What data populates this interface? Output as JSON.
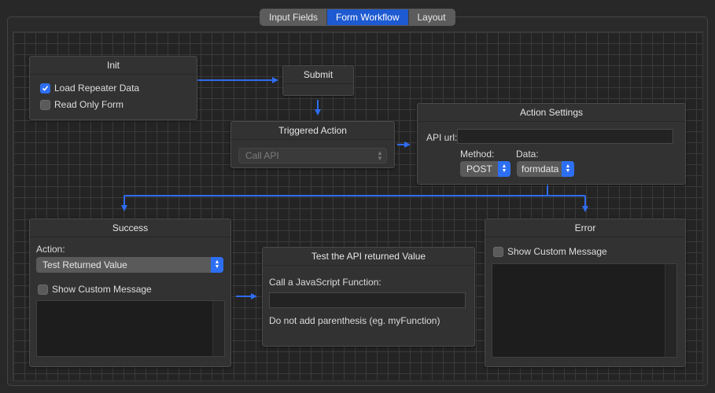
{
  "tabs": [
    "Input Fields",
    "Form Workflow",
    "Layout"
  ],
  "active_tab": "Form Workflow",
  "colors": {
    "accent": "#1e5ad1",
    "connector": "#2f6cf0"
  },
  "init": {
    "title": "Init",
    "load_repeater": {
      "label": "Load Repeater Data",
      "checked": true
    },
    "read_only": {
      "label": "Read Only Form",
      "checked": false
    }
  },
  "submit": {
    "title": "Submit"
  },
  "triggered": {
    "title": "Triggered Action",
    "selected": "Call API"
  },
  "action_settings": {
    "title": "Action Settings",
    "api_url_label": "API url:",
    "api_url_value": "",
    "method_label": "Method:",
    "method_value": "POST",
    "data_label": "Data:",
    "data_value": "formdata"
  },
  "success": {
    "title": "Success",
    "action_label": "Action:",
    "action_value": "Test Returned Value",
    "show_msg": {
      "label": "Show Custom Message",
      "checked": false
    }
  },
  "test_api": {
    "title": "Test the API returned Value",
    "call_label": "Call a JavaScript Function:",
    "call_value": "",
    "hint": "Do not add parenthesis (eg. myFunction)"
  },
  "error": {
    "title": "Error",
    "show_msg": {
      "label": "Show Custom Message",
      "checked": false
    }
  }
}
